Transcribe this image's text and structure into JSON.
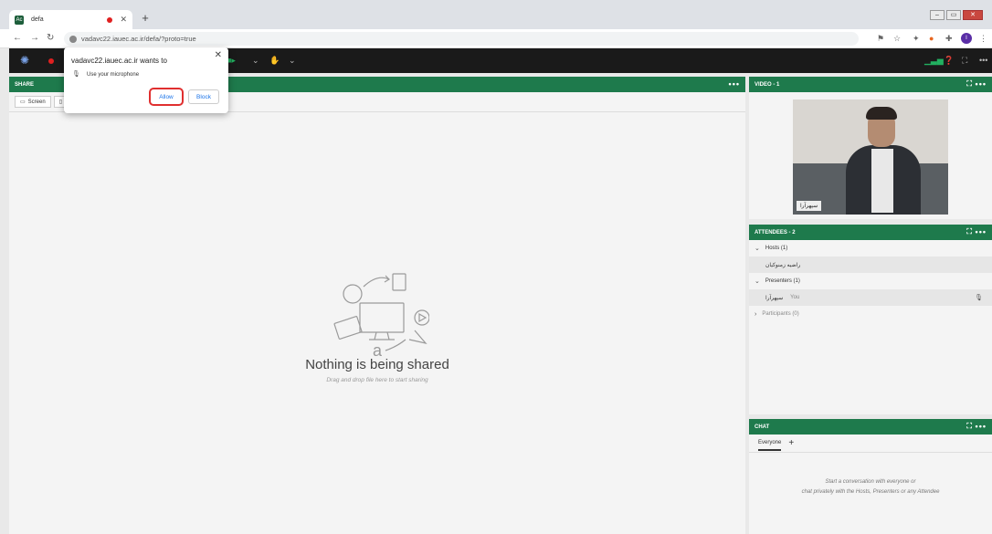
{
  "browser": {
    "tab_title": "defa",
    "url": "vadavc22.iauec.ac.ir/defa/?proto=true",
    "profile_initial": "I"
  },
  "permission_popup": {
    "title": "vadavc22.iauec.ac.ir wants to",
    "request": "Use your microphone",
    "allow_label": "Allow",
    "block_label": "Block"
  },
  "share_pod": {
    "title": "SHARE",
    "screen_button": "Screen",
    "empty_title": "Nothing is being shared",
    "empty_hint": "Drag and drop file here to start sharing"
  },
  "video_pod": {
    "title": "VIDEO - 1",
    "participant_name": "سپهرآرا"
  },
  "attendees_pod": {
    "title": "ATTENDEES - 2",
    "hosts_label": "Hosts (1)",
    "host_name": "راضیه زمنوکیان",
    "presenters_label": "Presenters (1)",
    "presenter_name": "سپهرآرا",
    "presenter_you": "You",
    "participants_label": "Participants (0)"
  },
  "chat_pod": {
    "title": "CHAT",
    "tab_label": "Everyone",
    "empty_line1": "Start a conversation with everyone or",
    "empty_line2": "chat privately with the Hosts, Presenters or any Attendee"
  },
  "colors": {
    "pod_header": "#1e7a4c",
    "toolbar": "#1a1a1a",
    "allow_highlight": "#e02f2f"
  }
}
